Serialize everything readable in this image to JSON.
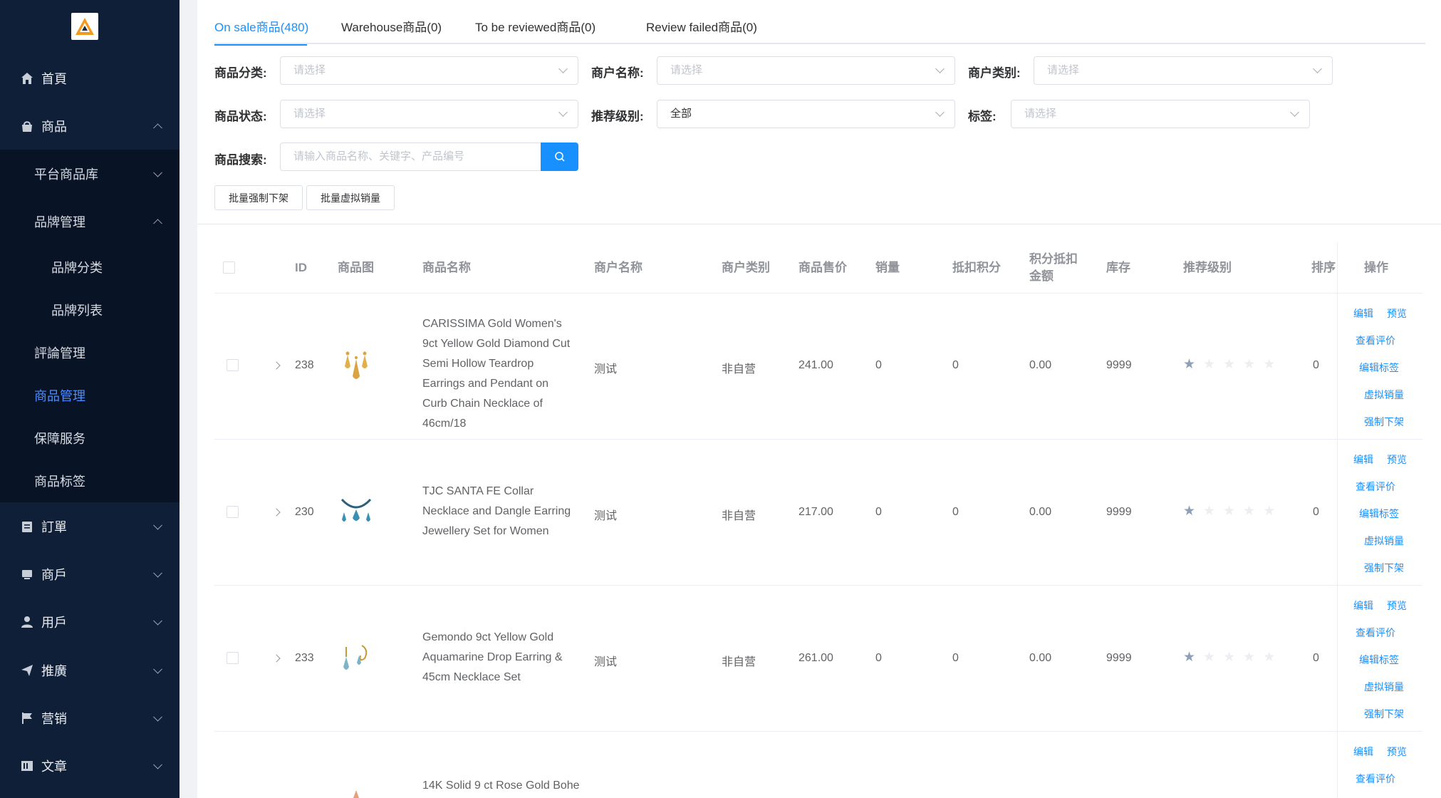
{
  "sidebar": {
    "logo": "brand-logo",
    "items": [
      {
        "label": "首頁",
        "icon": "home-icon"
      },
      {
        "label": "商品",
        "icon": "shop-icon"
      },
      {
        "label": "訂單",
        "icon": "order-icon"
      },
      {
        "label": "商戶",
        "icon": "merchant-icon"
      },
      {
        "label": "用戶",
        "icon": "user-icon"
      },
      {
        "label": "推廣",
        "icon": "send-icon"
      },
      {
        "label": "营销",
        "icon": "flag-icon"
      },
      {
        "label": "文章",
        "icon": "article-icon"
      }
    ],
    "submenu": [
      {
        "label": "平台商品库"
      },
      {
        "label": "品牌管理"
      },
      {
        "label": "品牌分类"
      },
      {
        "label": "品牌列表"
      },
      {
        "label": "評論管理"
      },
      {
        "label": "商品管理"
      },
      {
        "label": "保障服务"
      },
      {
        "label": "商品标签"
      }
    ]
  },
  "tabs": [
    {
      "label": "On sale商品(480)"
    },
    {
      "label": "Warehouse商品(0)"
    },
    {
      "label": "To be reviewed商品(0)"
    },
    {
      "label": "Review failed商品(0)"
    }
  ],
  "filters": {
    "category_label": "商品分类:",
    "category_placeholder": "请选择",
    "merchant_name_label": "商户名称:",
    "merchant_name_placeholder": "请选择",
    "merchant_type_label": "商户类别:",
    "merchant_type_placeholder": "请选择",
    "status_label": "商品状态:",
    "status_placeholder": "请选择",
    "recommend_label": "推荐级别:",
    "recommend_value": "全部",
    "tag_label": "标签:",
    "tag_placeholder": "请选择",
    "search_label": "商品搜索:",
    "search_placeholder": "请输入商品名称、关键字、产品编号"
  },
  "buttons": {
    "batch_offshelf": "批量强制下架",
    "batch_virtual_sales": "批量虚拟销量"
  },
  "table": {
    "headers": {
      "id": "ID",
      "image": "商品图",
      "name": "商品名称",
      "merchant_name": "商户名称",
      "merchant_type": "商户类别",
      "price": "商品售价",
      "sales": "销量",
      "points_deduct": "抵扣积分",
      "points_amount": "积分抵扣金额",
      "stock": "库存",
      "recommend": "推荐级别",
      "sort": "排序",
      "ops": "操作"
    },
    "rows": [
      {
        "id": "238",
        "name": "CARISSIMA Gold Women's 9ct Yellow Gold Diamond Cut Semi Hollow Teardrop Earrings and Pendant on Curb Chain Necklace of 46cm/18",
        "merchant": "测试",
        "type": "非自营",
        "price": "241.00",
        "sales": "0",
        "points": "0",
        "points_amount": "0.00",
        "stock": "9999",
        "sort": "0",
        "rating": 1
      },
      {
        "id": "230",
        "name": "TJC SANTA FE Collar Necklace and Dangle Earring Jewellery Set for Women",
        "merchant": "测试",
        "type": "非自营",
        "price": "217.00",
        "sales": "0",
        "points": "0",
        "points_amount": "0.00",
        "stock": "9999",
        "sort": "0",
        "rating": 1
      },
      {
        "id": "233",
        "name": "Gemondo 9ct Yellow Gold Aquamarine Drop Earring & 45cm Necklace Set",
        "merchant": "测试",
        "type": "非自营",
        "price": "261.00",
        "sales": "0",
        "points": "0",
        "points_amount": "0.00",
        "stock": "9999",
        "sort": "0",
        "rating": 1
      },
      {
        "name": "14K Solid 9 ct Rose Gold Bohe"
      }
    ],
    "ops": {
      "edit": "编辑",
      "preview": "预览",
      "view_reviews": "查看评价",
      "edit_tags": "编辑标签",
      "virtual_sales": "虚拟销量",
      "force_offshelf": "强制下架"
    }
  },
  "colors": {
    "sidebar_bg": "#0f1f38",
    "submenu_bg": "#081325",
    "accent": "#1890ff",
    "active_menu": "#4c8dff"
  }
}
